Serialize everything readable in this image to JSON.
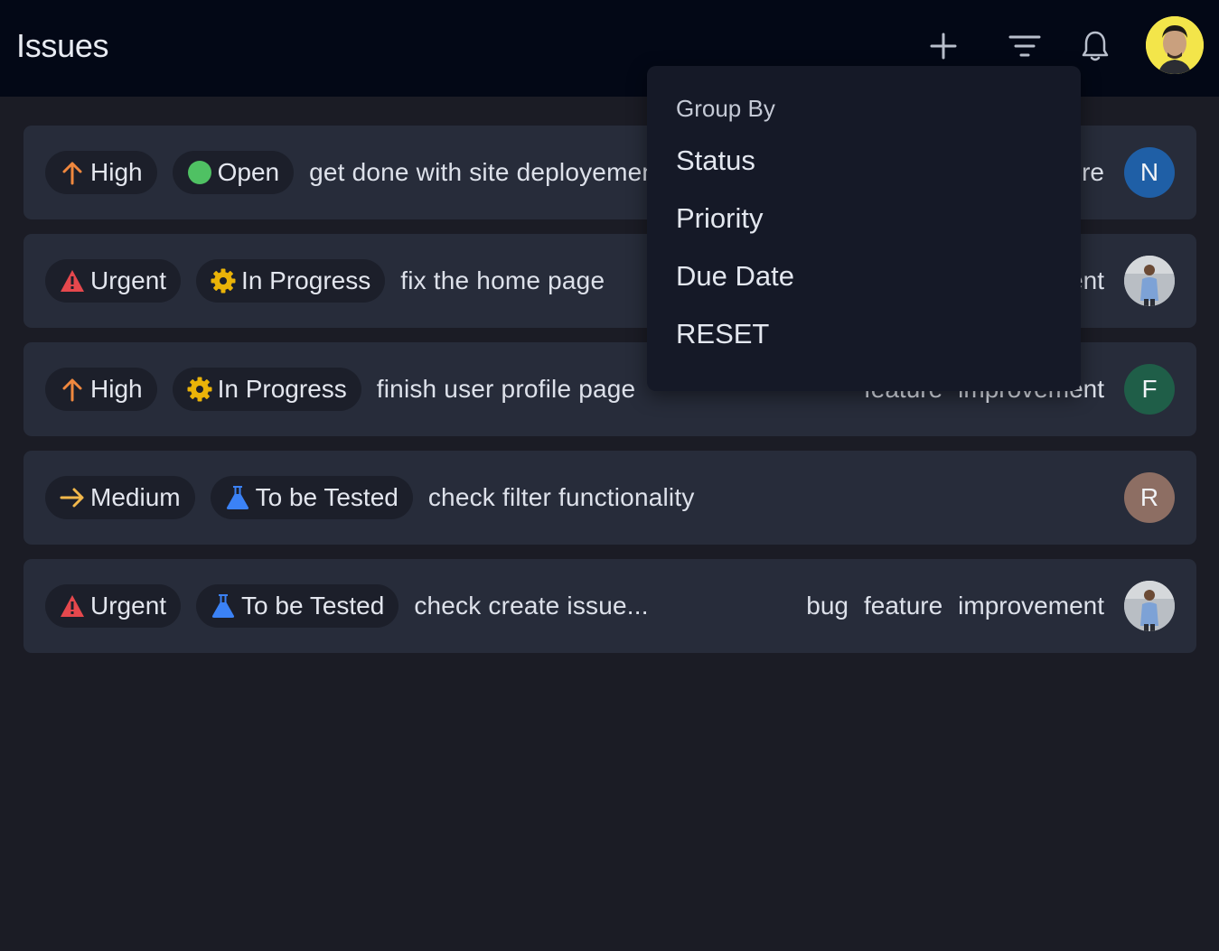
{
  "header": {
    "title": "Issues"
  },
  "icons": {
    "add": "plus-icon",
    "filter": "filter-icon",
    "notifications": "bell-icon",
    "profile": "user-photo"
  },
  "issues": [
    {
      "priority": "High",
      "priority_icon": "arrow-up-icon",
      "status": "Open",
      "status_icon": "open-dot-icon",
      "title": "get done with site deployement",
      "tags": [
        "feature"
      ],
      "assignee": "N"
    },
    {
      "priority": "Urgent",
      "priority_icon": "warning-icon",
      "status": "In Progress",
      "status_icon": "gear-icon",
      "title": "fix the home page",
      "tags": [
        "improvement"
      ],
      "assignee": ""
    },
    {
      "priority": "High",
      "priority_icon": "arrow-up-icon",
      "status": "In Progress",
      "status_icon": "gear-icon",
      "title": "finish user profile page",
      "tags": [
        "feature",
        "improvement"
      ],
      "assignee": "F"
    },
    {
      "priority": "Medium",
      "priority_icon": "arrow-right-icon",
      "status": "To be Tested",
      "status_icon": "flask-icon",
      "title": "check filter functionality",
      "tags": [],
      "assignee": "R"
    },
    {
      "priority": "Urgent",
      "priority_icon": "warning-icon",
      "status": "To be Tested",
      "status_icon": "flask-icon",
      "title": "check create issue...",
      "tags": [
        "bug",
        "feature",
        "improvement"
      ],
      "assignee": ""
    }
  ],
  "dropdown": {
    "heading": "Group By",
    "items": [
      "Status",
      "Priority",
      "Due Date",
      "RESET"
    ]
  },
  "colors": {
    "background": "#1b1c25",
    "header": "#030816",
    "card": "#272c3a",
    "pill": "#1c1f2a",
    "dropdown": "#151927",
    "high": "#f0883e",
    "urgent": "#e5484d",
    "medium": "#f2b84b",
    "open": "#4fc163",
    "in_progress": "#eab308",
    "to_be_tested": "#3b82f6",
    "avatar_n": "#1f5fa6",
    "avatar_f": "#1f5e48",
    "avatar_r": "#8d6e63"
  }
}
